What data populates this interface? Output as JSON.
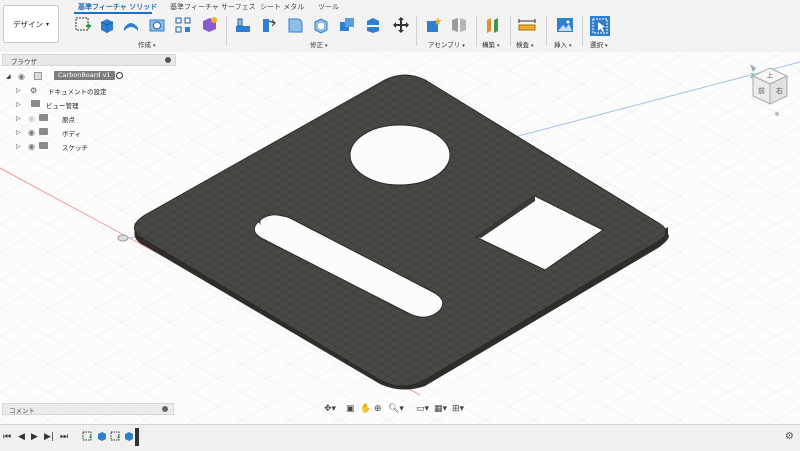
{
  "toolbar": {
    "workspace_label": "デザイン",
    "tabs": [
      {
        "label": "基準フィーチャ ソリッド",
        "active": true
      },
      {
        "label": "基準フィーチャ サーフェス",
        "active": false
      },
      {
        "label": "シート メタル",
        "active": false
      },
      {
        "label": "ツール",
        "active": false
      }
    ],
    "groups": [
      {
        "label": "作成"
      },
      {
        "label": "修正"
      },
      {
        "label": "アセンブリ"
      },
      {
        "label": "構築"
      },
      {
        "label": "検査"
      },
      {
        "label": "挿入"
      },
      {
        "label": "選択"
      }
    ]
  },
  "browser": {
    "title": "ブラウザ",
    "root": "CarbonBoard v1",
    "items": [
      {
        "label": "ドキュメントの設定",
        "icon": "gear-icon"
      },
      {
        "label": "ビュー管理",
        "icon": "folder-icon"
      },
      {
        "label": "原点",
        "icon": "folder-icon"
      },
      {
        "label": "ボディ",
        "icon": "folder-icon"
      },
      {
        "label": "スケッチ",
        "icon": "folder-icon"
      }
    ]
  },
  "comments": {
    "label": "コメント"
  },
  "viewcube": {
    "top": "上",
    "front": "前",
    "right": "右"
  },
  "colors": {
    "accent": "#1f6fc0",
    "plate": "#4a4844",
    "plate_edge": "#3a3835"
  }
}
